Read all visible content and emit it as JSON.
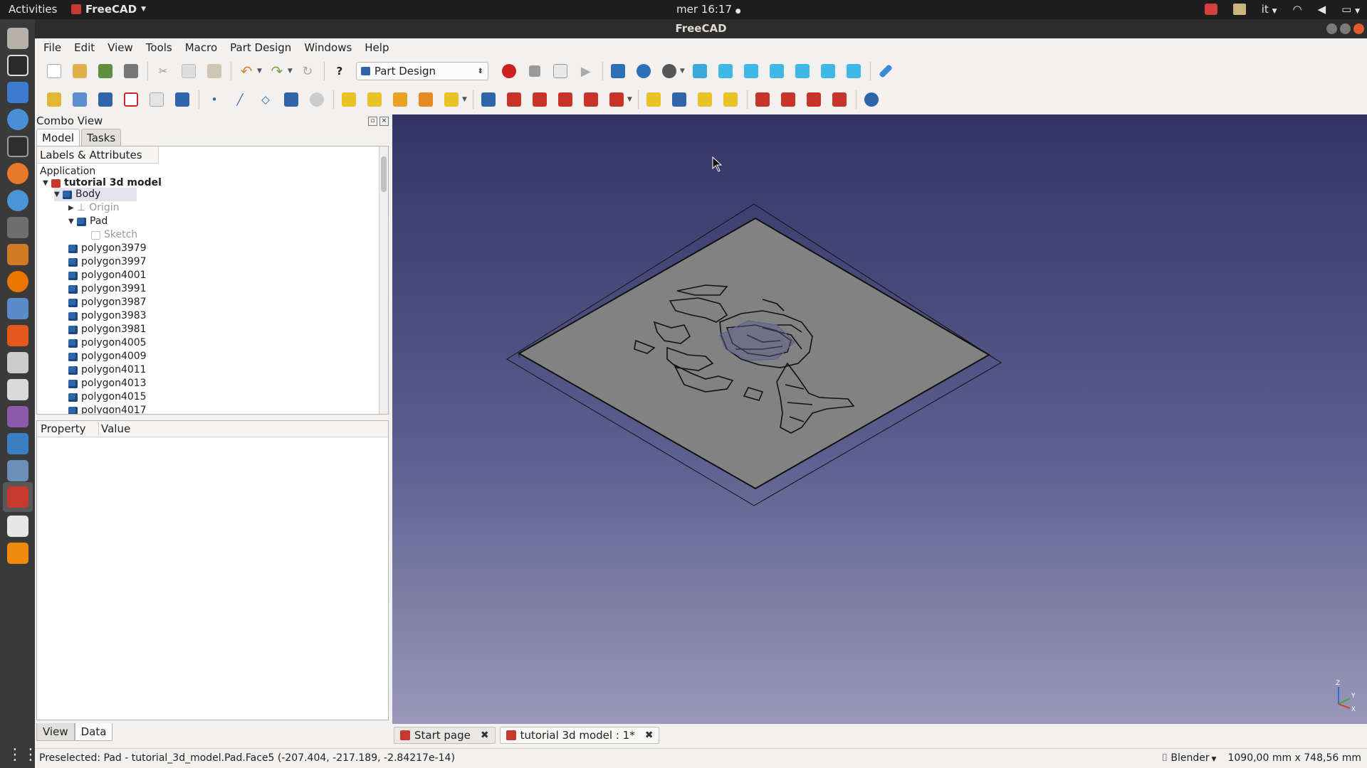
{
  "topbar": {
    "activities": "Activities",
    "app_name": "FreeCAD",
    "clock": "mer 16:17",
    "input_method": "it"
  },
  "window": {
    "title": "FreeCAD"
  },
  "menubar": [
    "File",
    "Edit",
    "View",
    "Tools",
    "Macro",
    "Part Design",
    "Windows",
    "Help"
  ],
  "toolbar": {
    "workbench": "Part Design"
  },
  "combo": {
    "title": "Combo View",
    "tabs": [
      "Model",
      "Tasks"
    ],
    "tree_header": "Labels & Attributes",
    "application": "Application",
    "document": "tutorial 3d model",
    "body": "Body",
    "origin": "Origin",
    "pad": "Pad",
    "sketch": "Sketch",
    "polygons": [
      "polygon3979",
      "polygon3997",
      "polygon4001",
      "polygon3991",
      "polygon3987",
      "polygon3983",
      "polygon3981",
      "polygon4005",
      "polygon4009",
      "polygon4011",
      "polygon4013",
      "polygon4015",
      "polygon4017"
    ],
    "prop_headers": [
      "Property",
      "Value"
    ],
    "view_tabs": [
      "View",
      "Data"
    ]
  },
  "doc_tabs": [
    {
      "label": "Start page"
    },
    {
      "label": "tutorial 3d model : 1*"
    }
  ],
  "status": {
    "message": "Preselected: Pad - tutorial_3d_model.Pad.Face5 (-207.404, -217.189, -2.84217e-14)",
    "navigation": "Blender",
    "dimensions": "1090,00 mm x 748,56 mm"
  },
  "axis_labels": {
    "z": "Z",
    "y": "Y",
    "x": "X"
  },
  "colors": {
    "viewport_top": "#333464",
    "viewport_bottom": "#9998b9",
    "plate": "#828282",
    "accent_record": "#cc1f1f",
    "part_blue": "#2f64a8"
  }
}
